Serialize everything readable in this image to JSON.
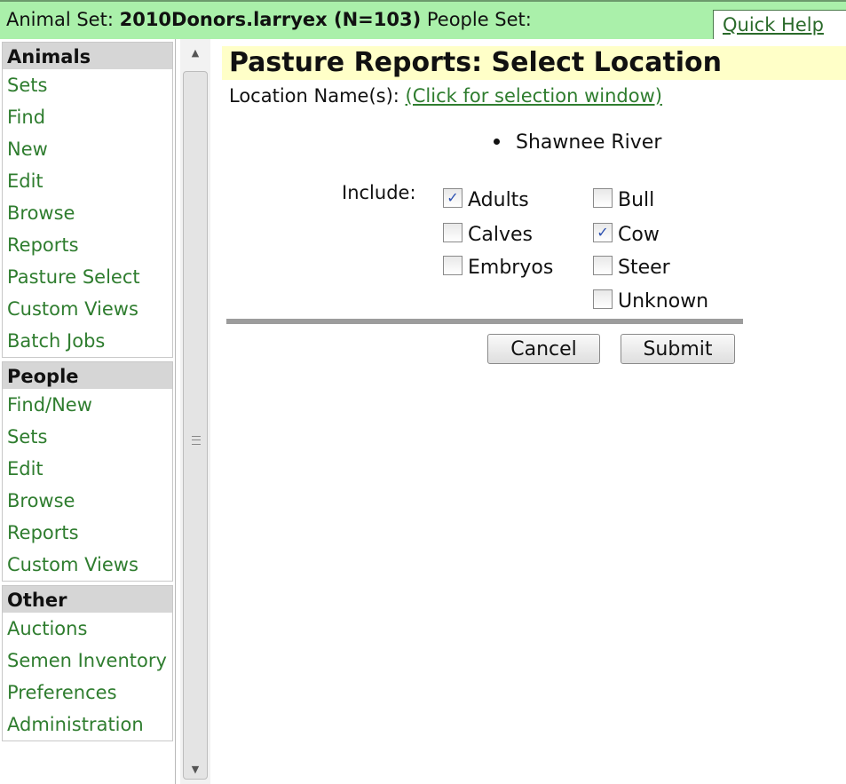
{
  "topbar": {
    "animal_set_prefix": "Animal Set: ",
    "animal_set_name": "2010Donors.larryex (N=103)",
    "people_set_label": " People Set:",
    "quick_help": "Quick Help"
  },
  "sidebar": {
    "animals": {
      "heading": "Animals",
      "items": [
        "Sets",
        "Find",
        "New",
        "Edit",
        "Browse",
        "Reports",
        "Pasture Select",
        "Custom Views",
        "Batch Jobs"
      ]
    },
    "people": {
      "heading": "People",
      "items": [
        "Find/New",
        "Sets",
        "Edit",
        "Browse",
        "Reports",
        "Custom Views"
      ]
    },
    "other": {
      "heading": "Other",
      "items": [
        "Auctions",
        "Semen Inventory",
        "Preferences",
        "Administration"
      ]
    }
  },
  "main": {
    "title": "Pasture Reports: Select Location",
    "location_label": "Location Name(s):",
    "location_link": "(Click for selection window)",
    "selected_location": "Shawnee River",
    "include_label": "Include:",
    "checkboxes": [
      {
        "label": "Adults",
        "checked": true
      },
      {
        "label": "Calves",
        "checked": false
      },
      {
        "label": "Embryos",
        "checked": false
      },
      {
        "label": "Bull",
        "checked": false
      },
      {
        "label": "Cow",
        "checked": true
      },
      {
        "label": "Steer",
        "checked": false
      },
      {
        "label": "Unknown",
        "checked": false
      }
    ],
    "cancel_label": "Cancel",
    "submit_label": "Submit"
  },
  "colors": {
    "topbar_bg": "#aaf0aa",
    "link_green": "#2f7d2f",
    "title_bg": "#ffffc8",
    "nav_head_bg": "#d6d6d6"
  }
}
